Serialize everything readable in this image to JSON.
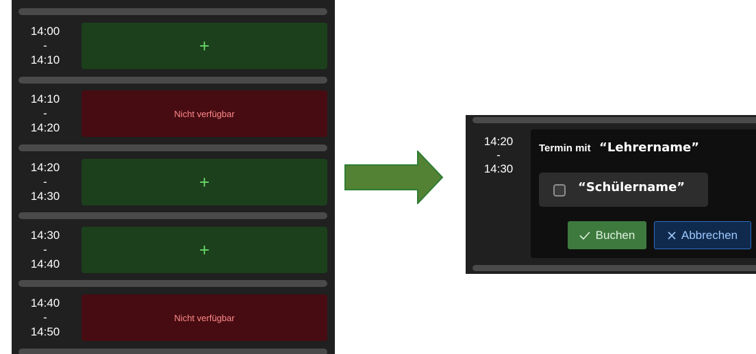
{
  "schedule": {
    "slots": [
      {
        "start": "14:00",
        "dash": "-",
        "end": "14:10",
        "status": "free",
        "icon": "plus-icon",
        "label": "+"
      },
      {
        "start": "14:10",
        "dash": "-",
        "end": "14:20",
        "status": "unavailable",
        "label": "Nicht verfügbar"
      },
      {
        "start": "14:20",
        "dash": "-",
        "end": "14:30",
        "status": "free",
        "icon": "plus-icon",
        "label": "+"
      },
      {
        "start": "14:30",
        "dash": "-",
        "end": "14:40",
        "status": "free",
        "icon": "plus-icon",
        "label": "+"
      },
      {
        "start": "14:40",
        "dash": "-",
        "end": "14:50",
        "status": "unavailable",
        "label": "Nicht verfügbar"
      }
    ]
  },
  "arrow": {
    "icon": "arrow-right-icon",
    "color": "#548235"
  },
  "booking": {
    "time": {
      "start": "14:20",
      "dash": "-",
      "end": "14:30"
    },
    "title_prefix": "Termin mit",
    "teacher_name": "“Lehrername”",
    "student_name": "“Schülername”",
    "student_checked": false,
    "book_icon": "check-icon",
    "book_label": "Buchen",
    "cancel_icon": "close-icon",
    "cancel_label": "Abbrechen"
  },
  "colors": {
    "free_slot": "#1c3f1c",
    "unavailable_slot": "#470c12",
    "book_button": "#3e7a3e",
    "cancel_button_border": "#2f6fc4"
  }
}
